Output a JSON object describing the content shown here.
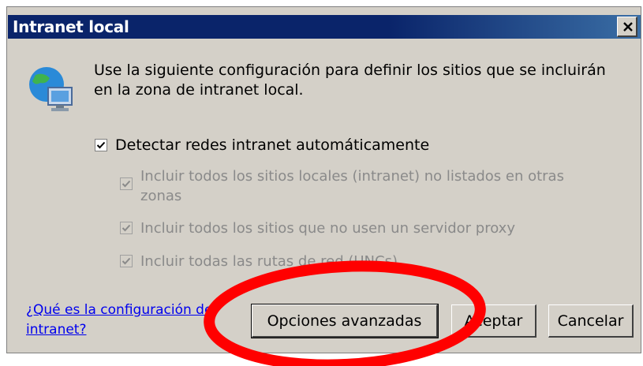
{
  "window": {
    "title": "Intranet local",
    "close_icon": "close-icon"
  },
  "description": "Use la siguiente configuración para definir los sitios que se incluirán en la zona de intranet local.",
  "icon": "network-globe-icon",
  "options": [
    {
      "label": "Detectar redes intranet automáticamente",
      "checked": true,
      "enabled": true
    },
    {
      "label": "Incluir todos los sitios locales (intranet) no listados en otras zonas",
      "checked": true,
      "enabled": false
    },
    {
      "label": "Incluir todos los sitios que no usen un servidor proxy",
      "checked": true,
      "enabled": false
    },
    {
      "label": "Incluir todas las rutas de red (UNCs)",
      "checked": true,
      "enabled": false
    }
  ],
  "help_link": "¿Qué es la configuración de intranet?",
  "buttons": {
    "advanced": "Opciones avanzadas",
    "ok": "Aceptar",
    "cancel": "Cancelar"
  },
  "colors": {
    "titlebar": "#0a246a",
    "dialog_bg": "#d4d0c8",
    "annotation": "#ff0000",
    "link": "#0000ee"
  }
}
